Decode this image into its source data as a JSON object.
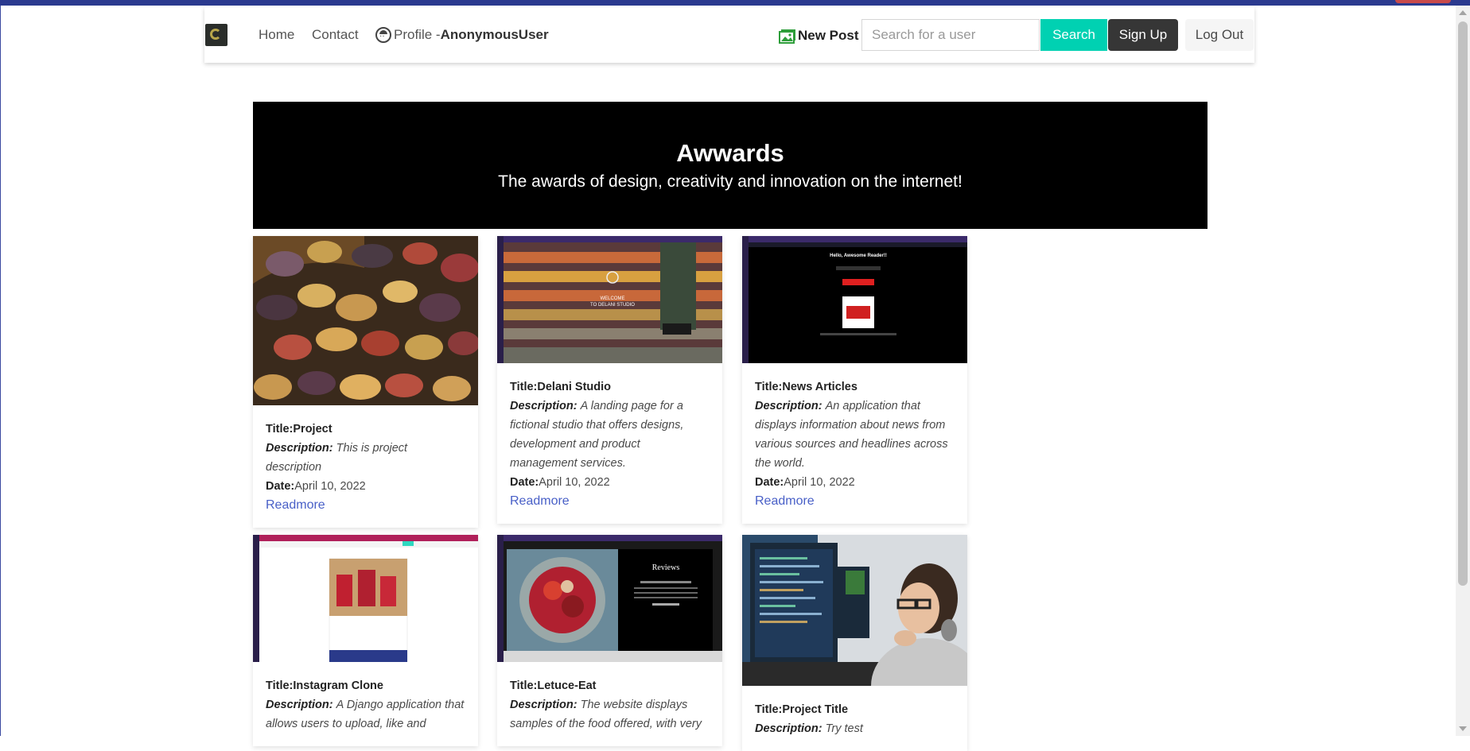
{
  "nav": {
    "home": "Home",
    "contact": "Contact",
    "profile_label": "Profile -",
    "profile_user": "AnonymousUser",
    "new_post": "New Post",
    "search_placeholder": "Search for a user",
    "search_button": "Search",
    "signup_button": "Sign Up",
    "logout_button": "Log Out"
  },
  "hero": {
    "title": "Awwards",
    "subtitle": "The awards of design, creativity and innovation on the internet!"
  },
  "labels": {
    "title": "Title:",
    "description": "Description:",
    "date": "Date:",
    "readmore": "Readmore"
  },
  "posts": [
    {
      "title": "Project",
      "description": "This is project description",
      "date": "April 10, 2022",
      "image": "potatoes-photo"
    },
    {
      "title": "Delani Studio",
      "description": "A landing page for a fictional studio that offers designs, development and product management services.",
      "date": "April 10, 2022",
      "image": "delani-studio-screenshot",
      "image_text": "WELCOME TO DELANI STUDIO"
    },
    {
      "title": "News Articles",
      "description": "An application that displays information about news from various sources and headlines across the world.",
      "date": "April 10, 2022",
      "image": "news-app-screenshot",
      "image_text": "Hello, Awesome Reader!!"
    },
    {
      "title": "Instagram Clone",
      "description": "A Django application that allows users to upload, like and",
      "image": "instagram-clone-screenshot"
    },
    {
      "title": "Letuce-Eat",
      "description": "The website displays samples of the food offered, with very",
      "image": "letuce-eat-screenshot",
      "image_text": "Reviews"
    },
    {
      "title": "Project Title",
      "description": "Try test",
      "image": "woman-at-computer-photo"
    }
  ],
  "colors": {
    "search_button": "#00d1b2",
    "signup_button": "#363636",
    "link": "#485fc7",
    "hero_bg": "#000000",
    "new_post_icon": "#2e9e3a"
  }
}
